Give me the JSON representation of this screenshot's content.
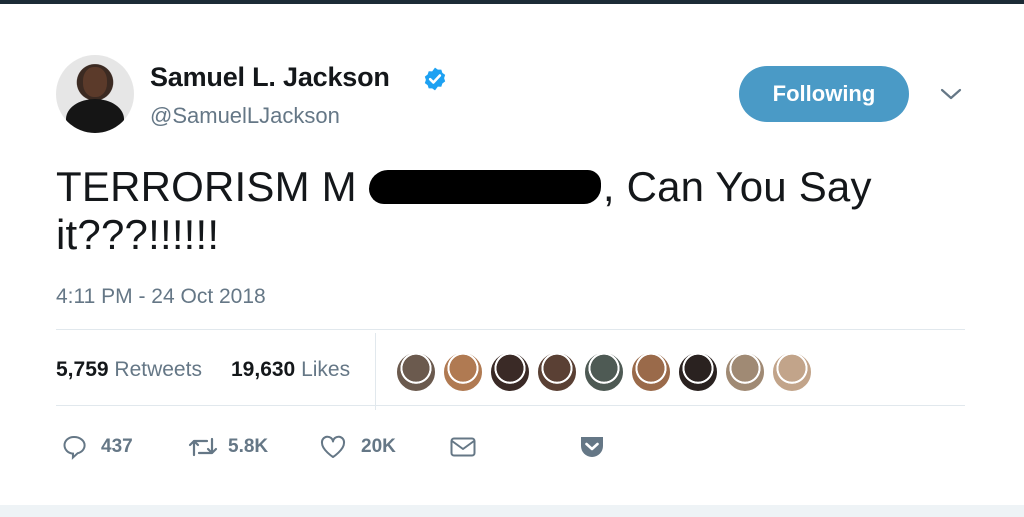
{
  "author": {
    "name": "Samuel L. Jackson",
    "handle": "@SamuelLJackson",
    "verified": true,
    "follow_label": "Following"
  },
  "tweet": {
    "text_before": "TERRORISM M",
    "text_after": ", Can You Say",
    "text_line2": "it???!!!!!!",
    "timestamp": "4:11 PM - 24 Oct 2018"
  },
  "stats": {
    "retweets_count": "5,759",
    "retweets_label": "Retweets",
    "likes_count": "19,630",
    "likes_label": "Likes"
  },
  "likers": [
    "#6b5a4e",
    "#b07a52",
    "#3a2a26",
    "#5a4034",
    "#4e5a54",
    "#9a6a4a",
    "#2a2220",
    "#a08a74",
    "#c2a48a"
  ],
  "actions": {
    "reply_count": "437",
    "retweet_count": "5.8K",
    "like_count": "20K"
  },
  "colors": {
    "accent": "#4a9ac6",
    "verified": "#1da1f2",
    "secondary_text": "#657786",
    "divider": "#e1e8ed"
  },
  "icons": [
    "verified-badge-icon",
    "chevron-down-icon",
    "reply-icon",
    "retweet-icon",
    "heart-icon",
    "envelope-icon",
    "pocket-icon"
  ]
}
